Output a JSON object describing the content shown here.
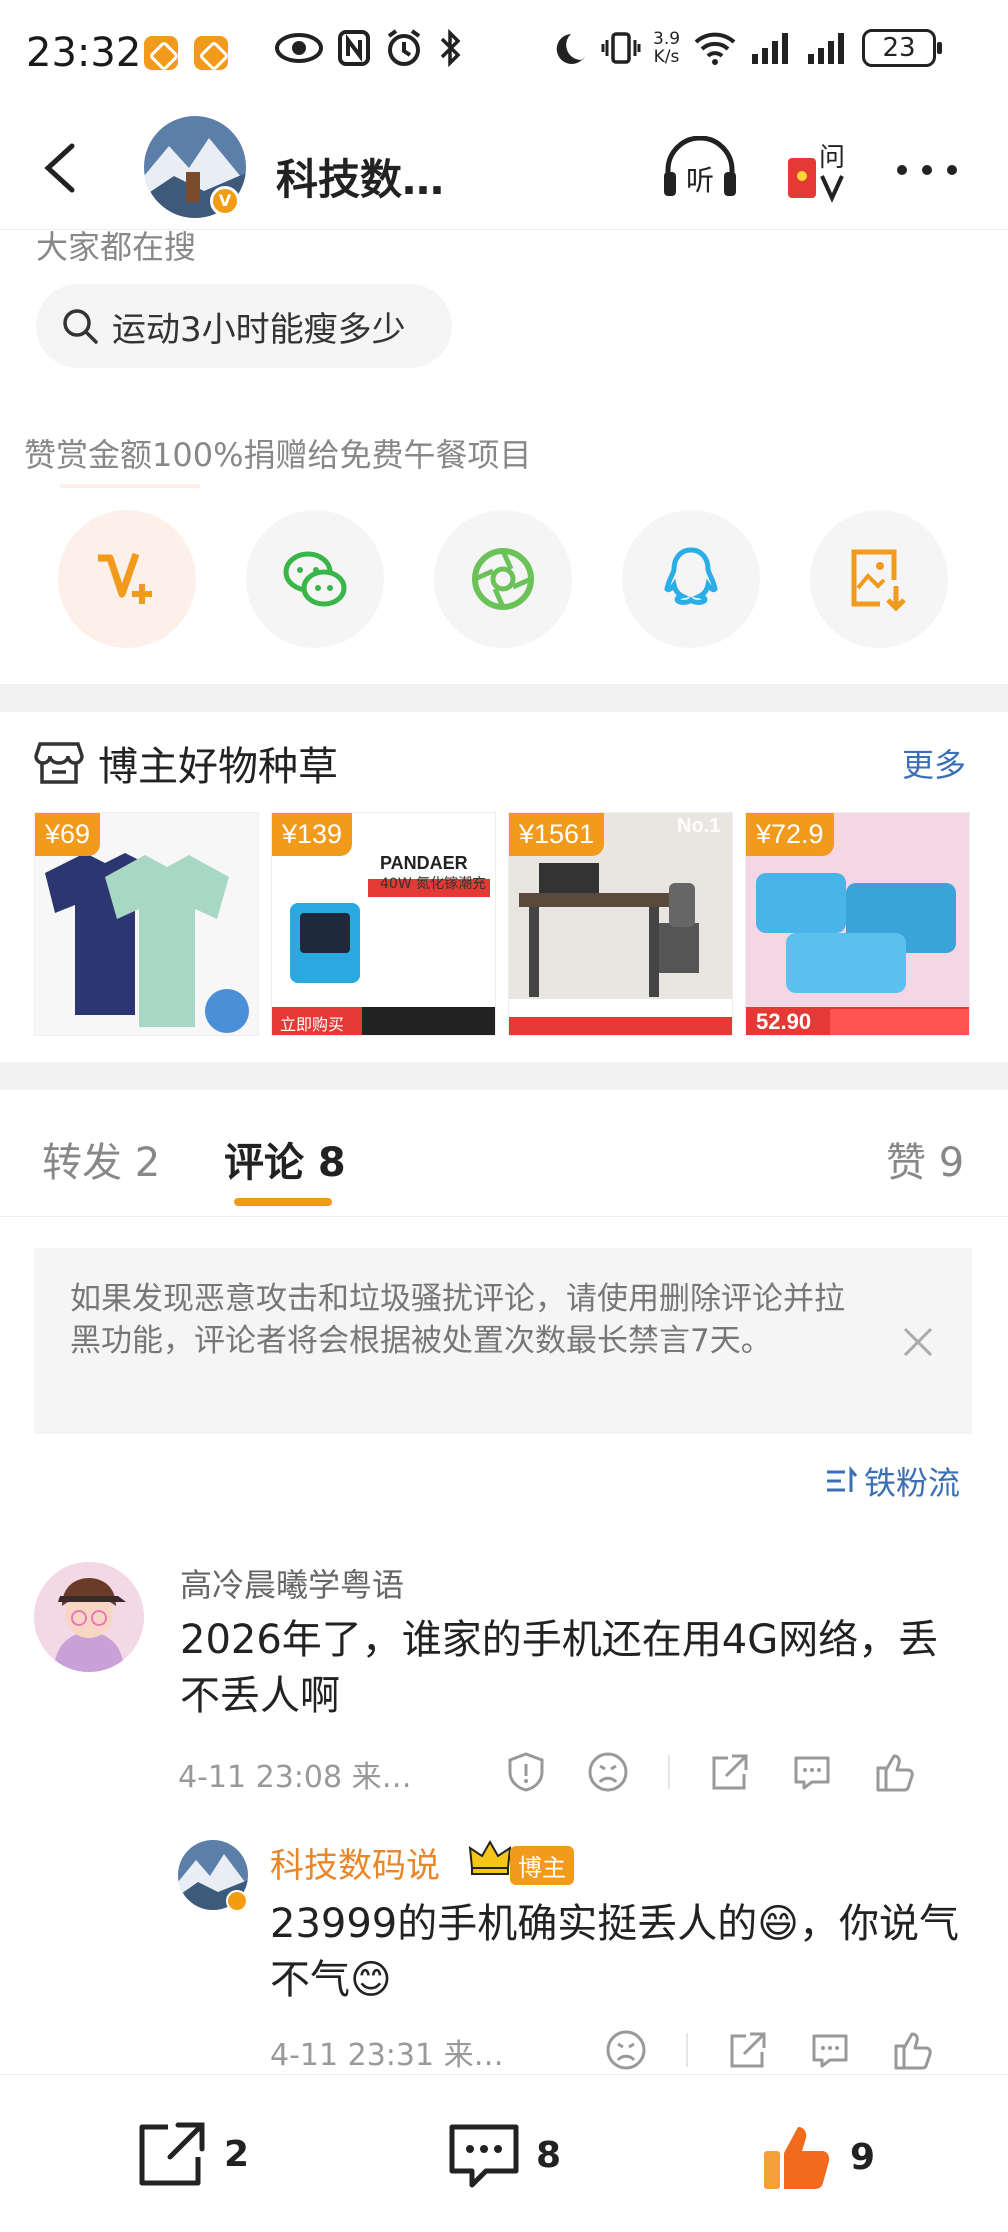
{
  "status_bar": {
    "time": "23:32",
    "network_speed_top": "3.9",
    "network_speed_bottom": "K/s",
    "battery": "23"
  },
  "header": {
    "title": "科技数…",
    "listen_label": "听",
    "ask_label": "问"
  },
  "hot_search": {
    "label": "大家都在搜",
    "query": "运动3小时能瘦多少"
  },
  "donation_text": "赞赏金额100%捐赠给免费午餐项目",
  "share_buttons": [
    "reward",
    "wechat",
    "moments",
    "qq",
    "save-image"
  ],
  "products": {
    "title": "博主好物种草",
    "more": "更多",
    "items": [
      {
        "price": "¥69"
      },
      {
        "price": "¥139",
        "brand": "PANDAER",
        "spec": "40W 氮化镓潮充",
        "tag": "立即购买"
      },
      {
        "price": "¥1561",
        "tag": "No.1"
      },
      {
        "price": "¥72.9",
        "bottom_price": "52.90"
      }
    ]
  },
  "tabs": {
    "repost": "转发 2",
    "comment": "评论 8",
    "like": "赞 9"
  },
  "notice": "如果发现恶意攻击和垃圾骚扰评论，请使用删除评论并拉黑功能，评论者将会根据被处置次数最长禁言7天。",
  "sort_label": "铁粉流",
  "comment": {
    "user": "高冷晨曦学粤语",
    "text": "2026年了，谁家的手机还在用4G网络，丢不丢人啊",
    "time": "4-11 23:08  来…"
  },
  "reply": {
    "user": "科技数码说",
    "badge": "博主",
    "text": "23999的手机确实挺丢人的😄，你说气不气😊",
    "time": "4-11 23:31  来…"
  },
  "bottom_bar": {
    "repost_count": "2",
    "comment_count": "8",
    "like_count": "9"
  }
}
